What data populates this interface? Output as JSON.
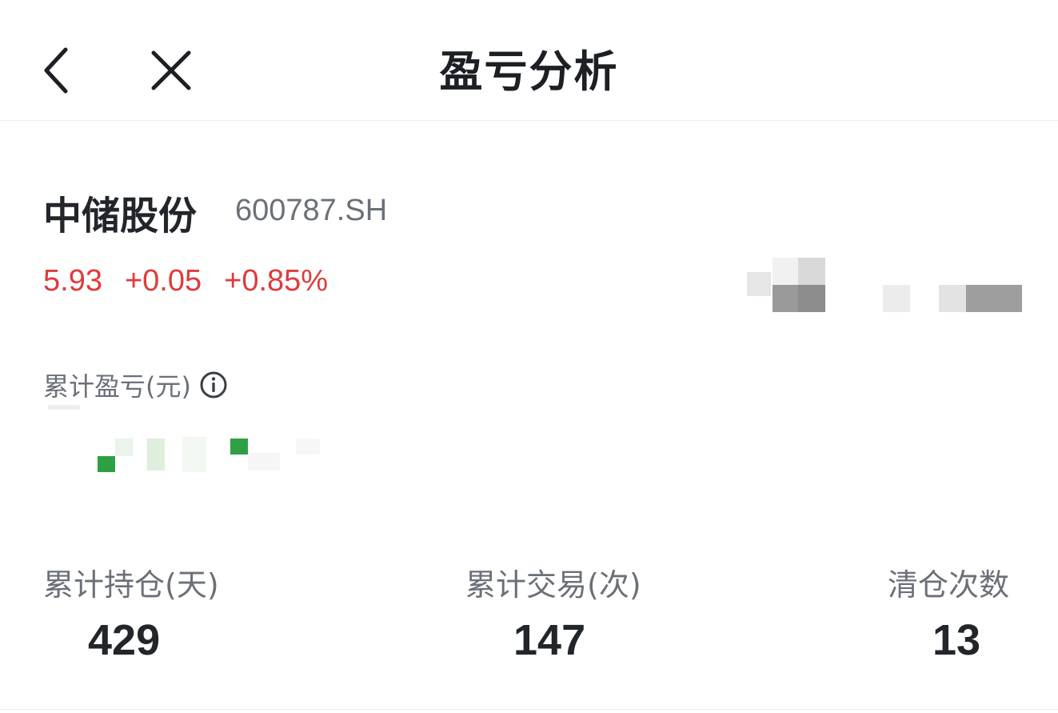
{
  "header": {
    "title": "盈亏分析",
    "back_icon": "chevron-left-icon",
    "close_icon": "close-icon"
  },
  "stock": {
    "name": "中储股份",
    "code": "600787.SH",
    "price": "5.93",
    "change": "+0.05",
    "change_pct": "+0.85%",
    "price_color": "#e03b3b"
  },
  "pnl": {
    "label": "累计盈亏(元)",
    "info_icon": "info-icon",
    "value_color": "#2ea043"
  },
  "stats": [
    {
      "label": "累计持仓(天)",
      "value": "429"
    },
    {
      "label": "累计交易(次)",
      "value": "147"
    },
    {
      "label": "清仓次数",
      "value": "13"
    }
  ]
}
